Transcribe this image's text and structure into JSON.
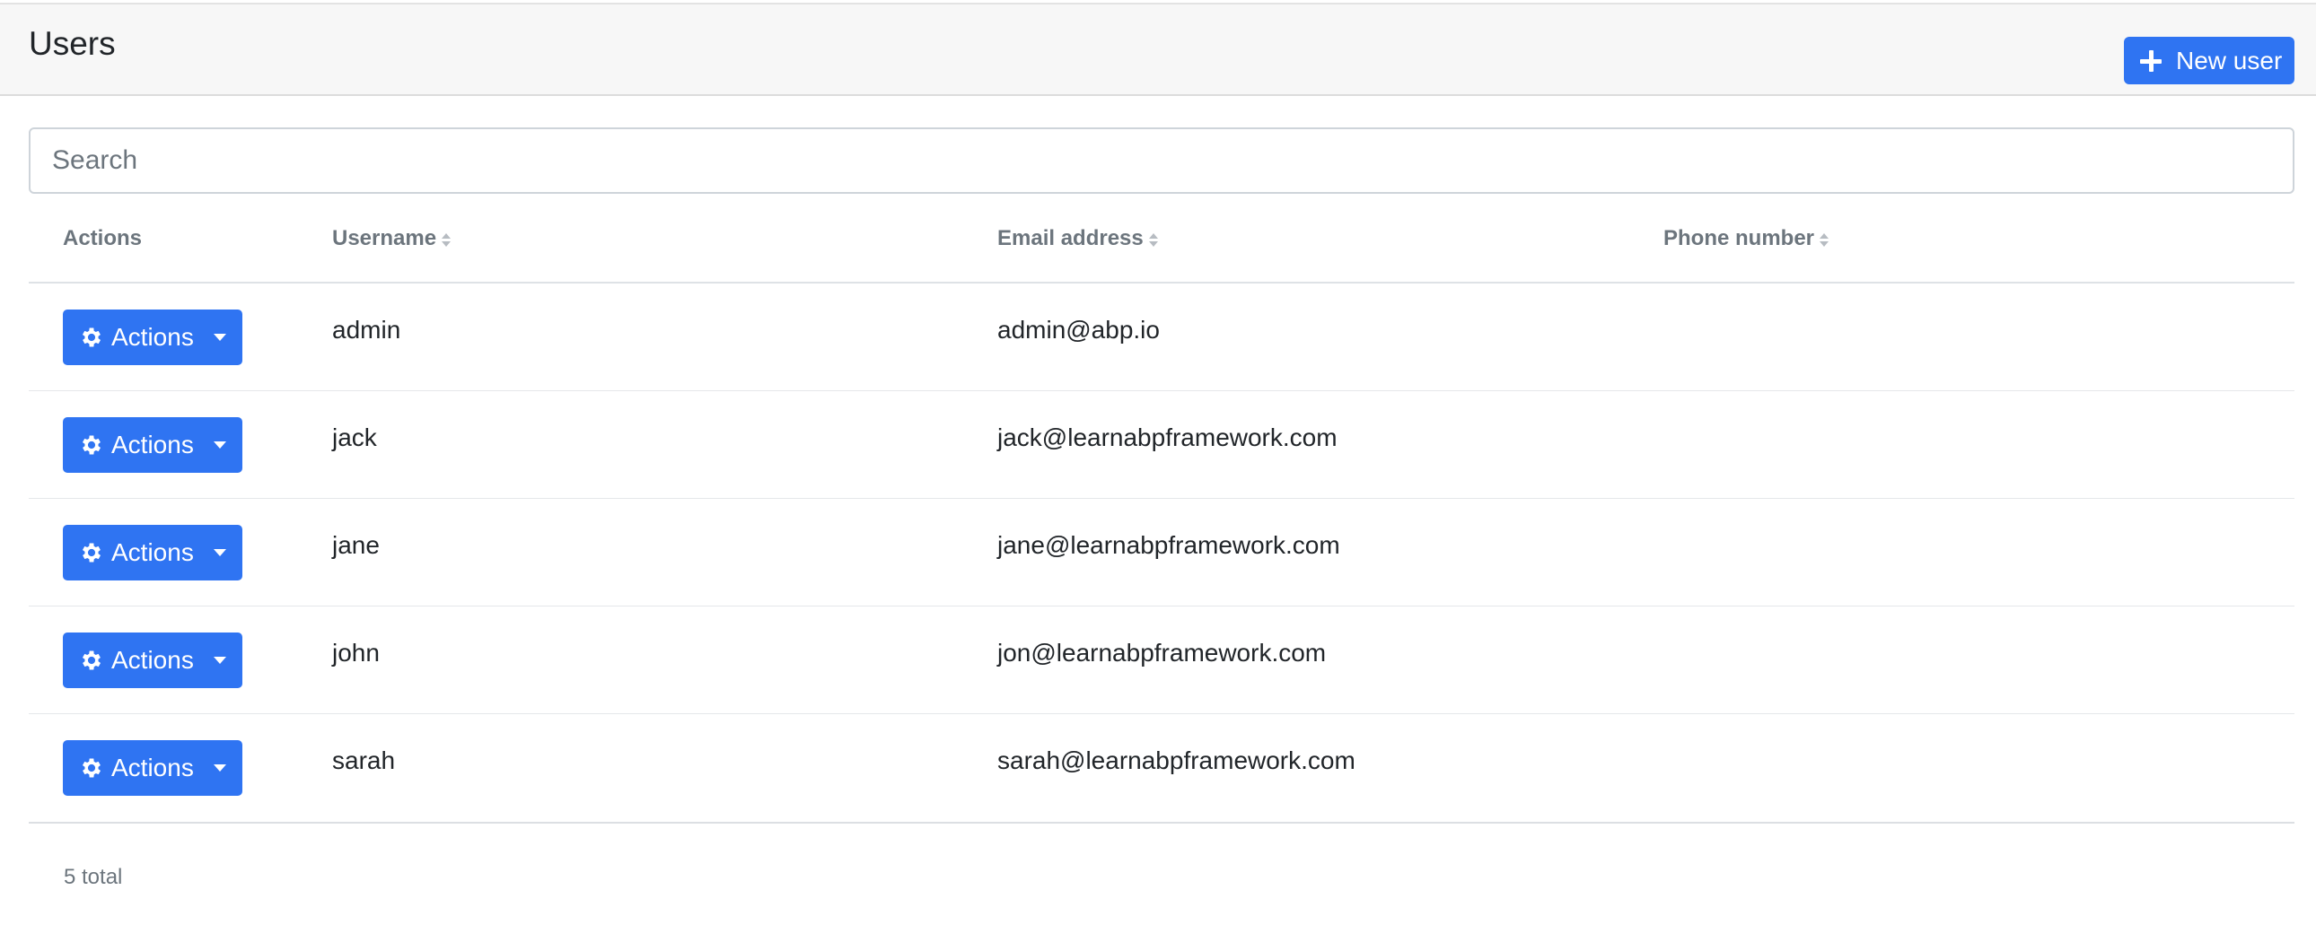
{
  "header": {
    "title": "Users",
    "new_user_label": "New user"
  },
  "search": {
    "placeholder": "Search",
    "value": ""
  },
  "table": {
    "columns": [
      "Actions",
      "Username",
      "Email address",
      "Phone number"
    ],
    "action_label": "Actions",
    "rows": [
      {
        "username": "admin",
        "email": "admin@abp.io",
        "phone": ""
      },
      {
        "username": "jack",
        "email": "jack@learnabpframework.com",
        "phone": ""
      },
      {
        "username": "jane",
        "email": "jane@learnabpframework.com",
        "phone": ""
      },
      {
        "username": "john",
        "email": "jon@learnabpframework.com",
        "phone": ""
      },
      {
        "username": "sarah",
        "email": "sarah@learnabpframework.com",
        "phone": ""
      }
    ]
  },
  "footer": {
    "total_label": "5 total"
  },
  "colors": {
    "primary": "#2f74f2",
    "header_bg": "#f7f7f7",
    "muted_text": "#6c757d"
  },
  "icons": {
    "new_user": "plus-icon",
    "actions": "gear-icon",
    "dropdown": "caret-down-icon",
    "sort": "sort-icon"
  }
}
